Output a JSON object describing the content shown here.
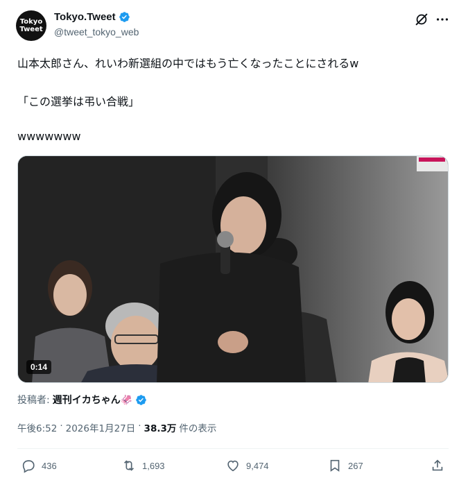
{
  "author": {
    "avatar_line1": "Tokyo",
    "avatar_line2": "Tweet",
    "display_name": "Tokyo.Tweet",
    "handle": "@tweet_tokyo_web",
    "verified_icon": "verified-badge-icon",
    "brand_color": "#1d9bf0"
  },
  "tweet": {
    "line1": "山本太郎さん、れいわ新選組の中ではもう亡くなったことにされるw",
    "line2": "「この選挙は弔い合戦」",
    "line3": "wwwwwww"
  },
  "media": {
    "duration": "0:14"
  },
  "poster": {
    "label": "投稿者:",
    "name": "週刊イカちゃん🦑"
  },
  "meta": {
    "time": "午後6:52",
    "sep1": "·",
    "date": "2026年1月27日",
    "sep2": "·",
    "views_count": "38.3万",
    "views_label": "件の表示"
  },
  "actions": {
    "replies": "436",
    "reposts": "1,693",
    "likes": "9,474",
    "bookmarks": "267"
  }
}
